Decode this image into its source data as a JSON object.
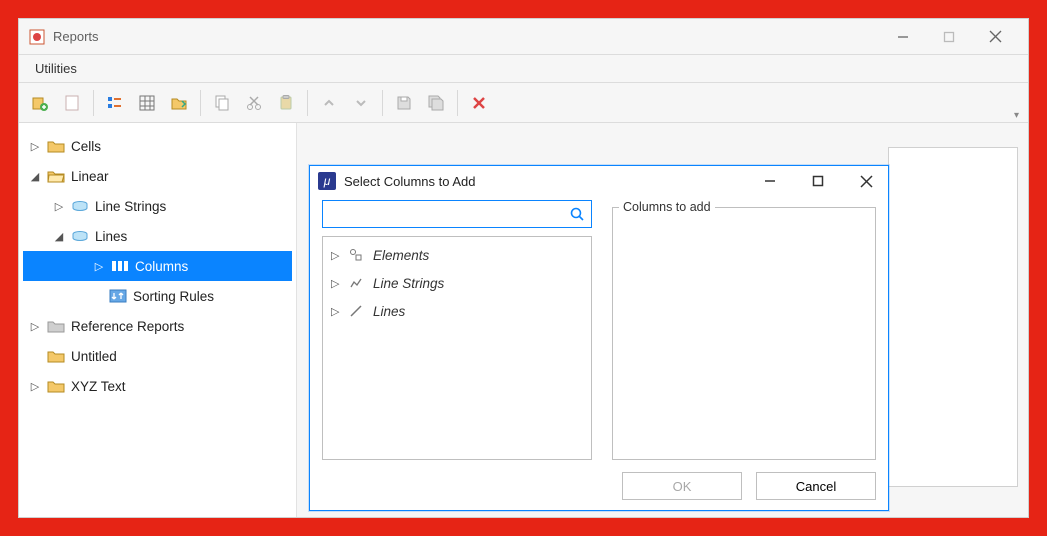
{
  "window": {
    "title": "Reports",
    "menubar": {
      "utilities": "Utilities"
    }
  },
  "toolbar_icons": {
    "new": "new-document",
    "dup": "duplicate",
    "list": "list-props",
    "table": "table",
    "export": "export-folder",
    "copy": "copy",
    "cut": "cut",
    "paste": "paste",
    "up": "move-up",
    "down": "move-down",
    "save": "save",
    "saveall": "save-all",
    "delete": "delete"
  },
  "tree": {
    "cells": "Cells",
    "linear": "Linear",
    "linestrings": "Line Strings",
    "lines": "Lines",
    "columns": "Columns",
    "sorting": "Sorting Rules",
    "refrep": "Reference Reports",
    "untitled": "Untitled",
    "xyz": "XYZ Text"
  },
  "dialog": {
    "title": "Select Columns to Add",
    "search_placeholder": "",
    "available": {
      "elements": "Elements",
      "linestrings": "Line Strings",
      "lines": "Lines"
    },
    "fieldset_legend": "Columns to add",
    "ok": "OK",
    "cancel": "Cancel"
  }
}
